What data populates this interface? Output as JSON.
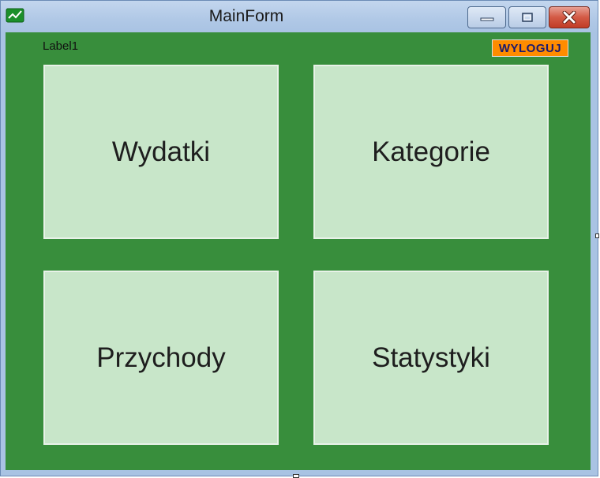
{
  "window": {
    "title": "MainForm",
    "icon": "app-chart-icon",
    "controls": {
      "minimize": "minimize-icon",
      "maximize": "maximize-icon",
      "close": "close-icon"
    }
  },
  "header": {
    "label": "Label1",
    "logout_label": "WYLOGUJ"
  },
  "tiles": [
    {
      "label": "Wydatki"
    },
    {
      "label": "Kategorie"
    },
    {
      "label": "Przychody"
    },
    {
      "label": "Statystyki"
    }
  ],
  "colors": {
    "background": "#388e3c",
    "tile": "#c8e6c9",
    "logout_button": "#ff8c00",
    "logout_text": "#1a1a6e"
  }
}
